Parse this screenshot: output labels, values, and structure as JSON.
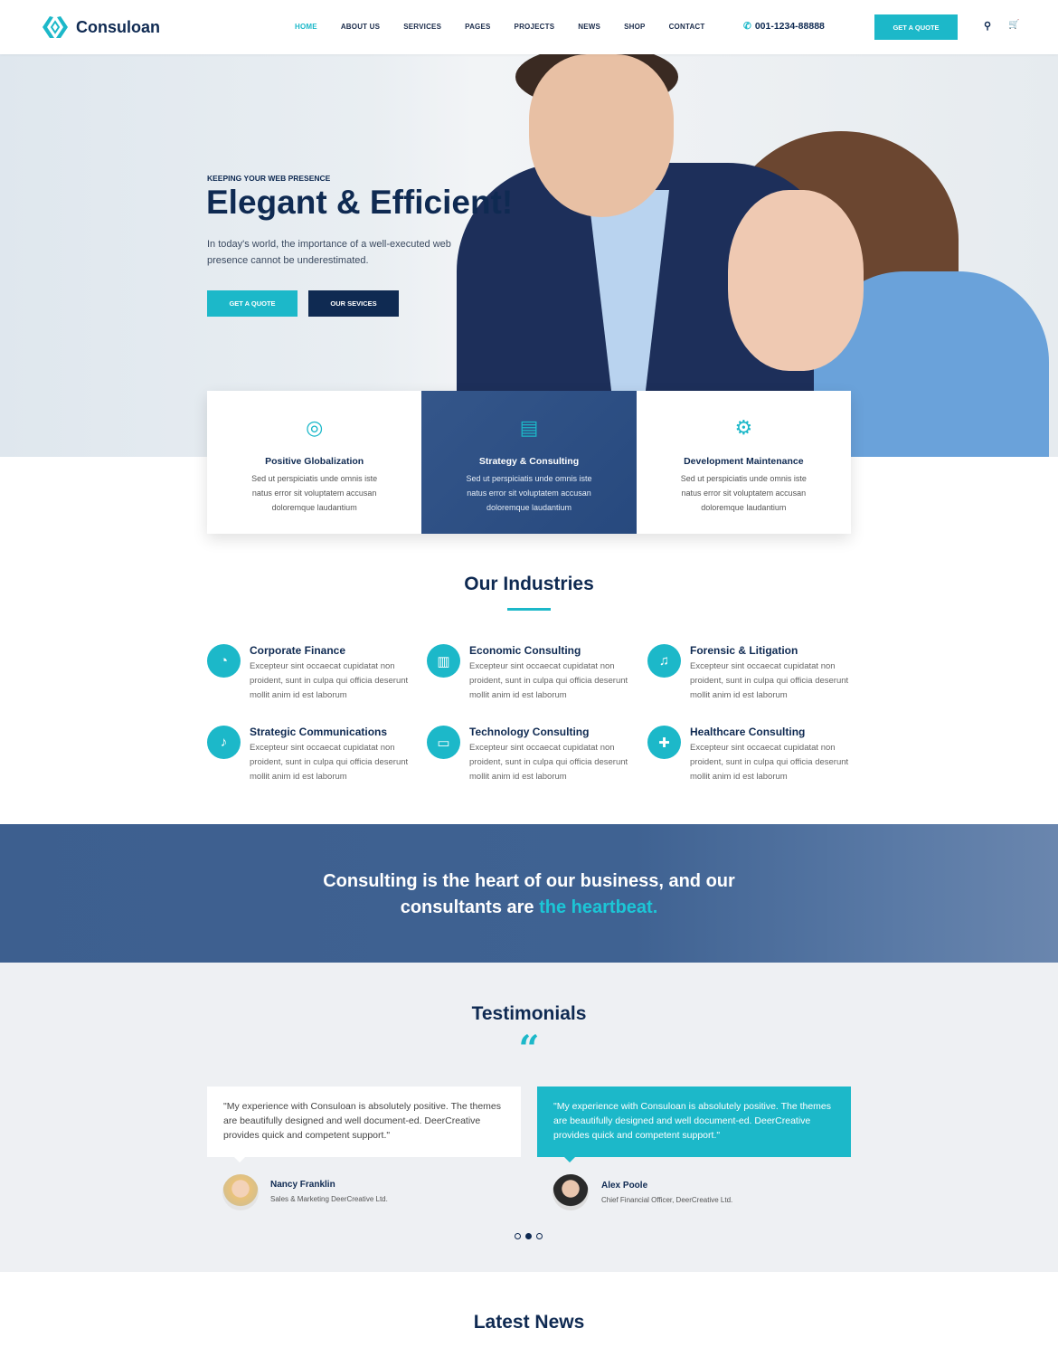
{
  "brand": {
    "name": "Consuloan",
    "accent": "#1cb8c9",
    "navy": "#0f2a52"
  },
  "nav": {
    "items": [
      "HOME",
      "ABOUT US",
      "SERVICES",
      "PAGES",
      "PROJECTS",
      "NEWS",
      "SHOP",
      "CONTACT"
    ],
    "active": "HOME",
    "phone": "001-1234-88888",
    "quote": "GET A QUOTE"
  },
  "hero": {
    "eyebrow": "KEEPING YOUR WEB PRESENCE",
    "title": "Elegant & Efficient!",
    "text": "In today's world, the importance of a well-executed web presence cannot be underestimated.",
    "btn_quote": "GET A QUOTE",
    "btn_services": "OUR SEVICES"
  },
  "features": [
    {
      "icon": "globe-icon",
      "title": "Positive Globalization",
      "text": "Sed ut perspiciatis unde omnis iste natus error sit voluptatem accusan doloremque laudantium"
    },
    {
      "icon": "document-search-icon",
      "title": "Strategy & Consulting",
      "text": "Sed ut perspiciatis unde omnis iste natus error sit voluptatem accusan doloremque laudantium"
    },
    {
      "icon": "gears-icon",
      "title": "Development Maintenance",
      "text": "Sed ut perspiciatis unde omnis iste natus error sit voluptatem accusan doloremque laudantium"
    }
  ],
  "industries": {
    "title": "Our Industries",
    "items": [
      {
        "icon": "pie-chart-icon",
        "title": "Corporate Finance",
        "text": "Excepteur sint occaecat cupidatat non proident, sunt in culpa qui officia deserunt mollit anim id est laborum"
      },
      {
        "icon": "bar-chart-icon",
        "title": "Economic Consulting",
        "text": "Excepteur sint occaecat cupidatat non proident, sunt in culpa qui officia deserunt mollit anim id est laborum"
      },
      {
        "icon": "bell-icon",
        "title": "Forensic & Litigation",
        "text": "Excepteur sint occaecat cupidatat non proident, sunt in culpa qui officia deserunt mollit anim id est laborum"
      },
      {
        "icon": "microphone-icon",
        "title": "Strategic Communications",
        "text": "Excepteur sint occaecat cupidatat non proident, sunt in culpa qui officia deserunt mollit anim id est laborum"
      },
      {
        "icon": "monitor-icon",
        "title": "Technology Consulting",
        "text": "Excepteur sint occaecat cupidatat non proident, sunt in culpa qui officia deserunt mollit anim id est laborum"
      },
      {
        "icon": "medical-kit-icon",
        "title": "Healthcare Consulting",
        "text": "Excepteur sint occaecat cupidatat non proident, sunt in culpa qui officia deserunt mollit anim id est laborum"
      }
    ]
  },
  "banner": {
    "text": "Consulting is the heart of our business, and our consultants are",
    "accent": "the heartbeat."
  },
  "testimonials": {
    "title": "Testimonials",
    "items": [
      {
        "quote": "\"My experience with Consuloan is absolutely positive. The themes are beautifully designed and well document-ed. DeerCreative provides quick and competent support.\"",
        "name": "Nancy Franklin",
        "role": "Sales & Marketing DeerCreative Ltd."
      },
      {
        "quote": "\"My experience with Consuloan is absolutely positive. The themes are beautifully designed and well document-ed. DeerCreative provides quick and competent support.\"",
        "name": "Alex Poole",
        "role": "Chief Financial Officer, DeerCreative Ltd."
      }
    ],
    "active_dot": 2,
    "dots": 3
  },
  "news": {
    "title": "Latest News"
  }
}
